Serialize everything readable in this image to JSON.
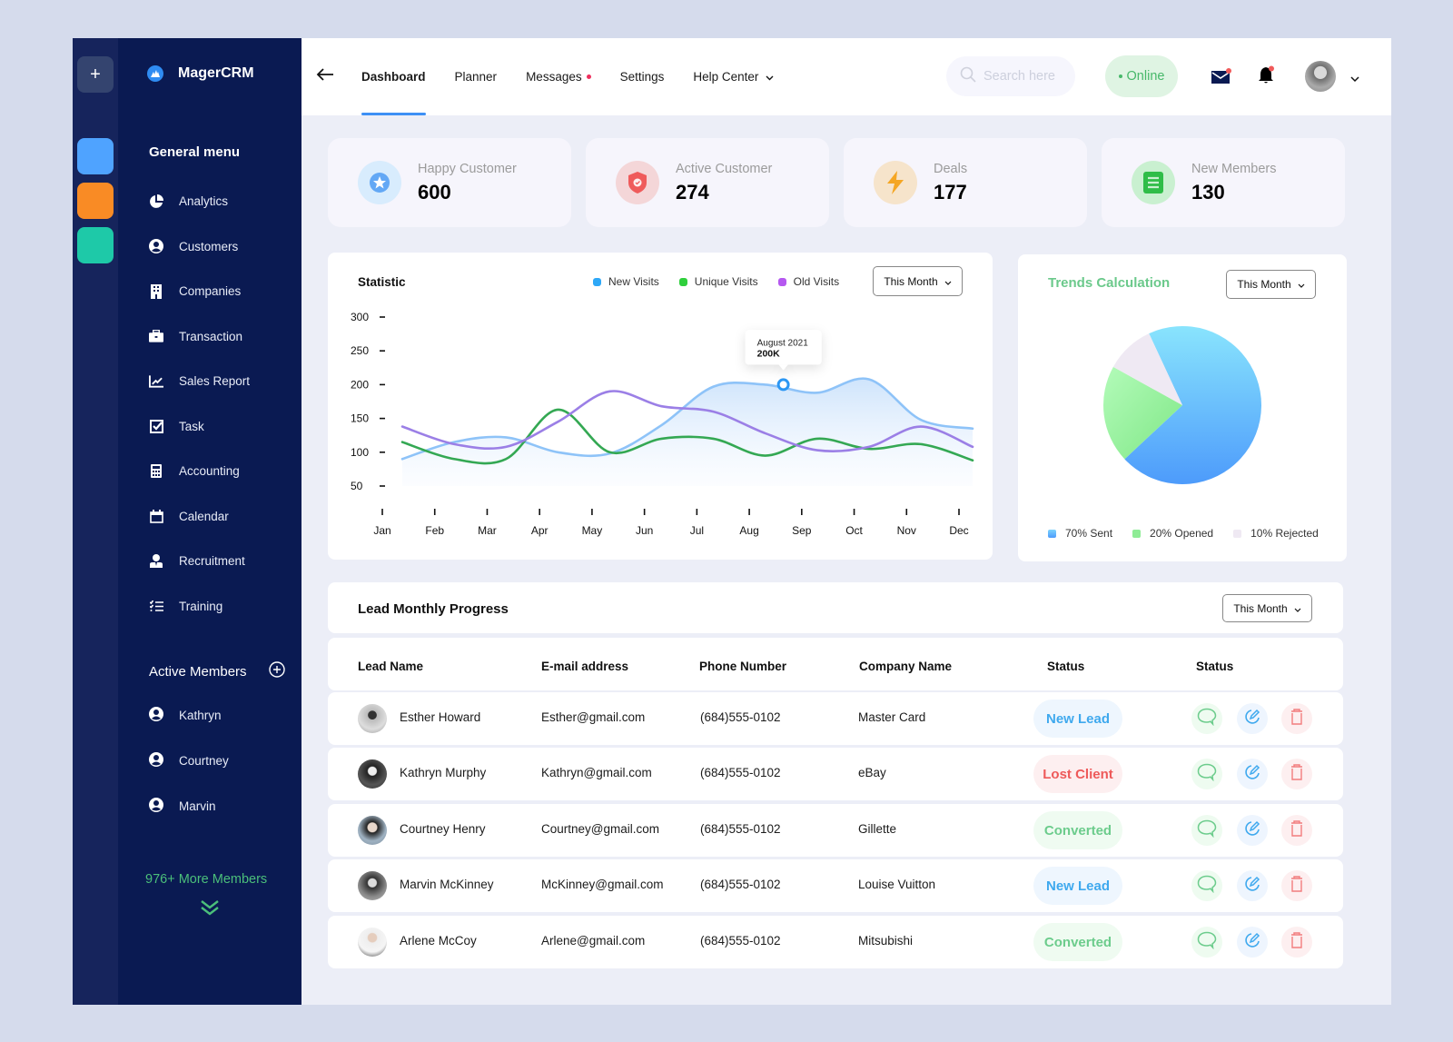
{
  "app": {
    "name": "MagerCRM"
  },
  "rail": {
    "add_label": "+"
  },
  "sidebar": {
    "section_title": "General menu",
    "items": [
      {
        "label": "Analytics",
        "icon": "pie-chart-icon"
      },
      {
        "label": "Customers",
        "icon": "user-circle-icon"
      },
      {
        "label": "Companies",
        "icon": "building-icon"
      },
      {
        "label": "Transaction",
        "icon": "briefcase-icon"
      },
      {
        "label": "Sales Report",
        "icon": "line-chart-icon"
      },
      {
        "label": "Task",
        "icon": "checkbox-icon"
      },
      {
        "label": "Accounting",
        "icon": "calculator-icon"
      },
      {
        "label": "Calendar",
        "icon": "calendar-icon"
      },
      {
        "label": "Recruitment",
        "icon": "recruiter-icon"
      },
      {
        "label": "Training",
        "icon": "checklist-icon"
      }
    ],
    "members_title": "Active Members",
    "members": [
      "Kathryn",
      "Courtney",
      "Marvin"
    ],
    "more_members": "976+ More Members"
  },
  "topbar": {
    "tabs": [
      {
        "label": "Dashboard",
        "active": true
      },
      {
        "label": "Planner"
      },
      {
        "label": "Messages",
        "has_dot": true
      },
      {
        "label": "Settings"
      },
      {
        "label": "Help Center",
        "has_chevron": true
      }
    ],
    "search_placeholder": "Search here",
    "status": "Online"
  },
  "stats": [
    {
      "label": "Happy Customer",
      "value": "600",
      "icon": "star-icon",
      "color": "#63a8f5"
    },
    {
      "label": "Active Customer",
      "value": "274",
      "icon": "shield-icon",
      "color": "#ef5b5b"
    },
    {
      "label": "Deals",
      "value": "177",
      "icon": "lightning-icon",
      "color": "#f5a623"
    },
    {
      "label": "New Members",
      "value": "130",
      "icon": "document-icon",
      "color": "#2fbd48"
    }
  ],
  "chart_data": [
    {
      "type": "line",
      "title": "Statistic",
      "filter": "This Month",
      "categories": [
        "Jan",
        "Feb",
        "Mar",
        "Apr",
        "May",
        "Jun",
        "Jul",
        "Aug",
        "Sep",
        "Oct",
        "Nov",
        "Dec"
      ],
      "yticks": [
        300,
        250,
        200,
        150,
        100,
        50
      ],
      "ylim": [
        50,
        300
      ],
      "series": [
        {
          "name": "New Visits",
          "color": "#8ec3f8",
          "values": [
            90,
            115,
            122,
            100,
            98,
            140,
            197,
            200,
            188,
            208,
            148,
            135
          ]
        },
        {
          "name": "Unique Visits",
          "color": "#34a853",
          "values": [
            115,
            90,
            90,
            163,
            100,
            120,
            120,
            95,
            120,
            105,
            112,
            88
          ]
        },
        {
          "name": "Old Visits",
          "color": "#9b7fe6",
          "values": [
            138,
            112,
            108,
            145,
            190,
            168,
            160,
            128,
            103,
            108,
            138,
            108
          ]
        }
      ],
      "tooltip": {
        "month": "August 2021",
        "value": "200K",
        "category": "Aug",
        "x": 7.35,
        "y": 200
      },
      "legend_position": "top-right"
    },
    {
      "type": "pie",
      "title": "Trends Calculation",
      "filter": "This Month",
      "slices": [
        {
          "label": "Sent",
          "value": 70,
          "legend": "70% Sent",
          "color": "#5aaaf9"
        },
        {
          "label": "Opened",
          "value": 20,
          "legend": "20% Opened",
          "color": "#8fec96"
        },
        {
          "label": "Rejected",
          "value": 10,
          "legend": "10% Rejected",
          "color": "#efe9f3"
        }
      ],
      "legend_position": "bottom"
    }
  ],
  "leads": {
    "title": "Lead Monthly Progress",
    "filter": "This Month",
    "columns": [
      "Lead Name",
      "E-mail address",
      "Phone Number",
      "Company Name",
      "Status",
      "Status"
    ],
    "rows": [
      {
        "name": "Esther Howard",
        "email": "Esther@gmail.com",
        "phone": "(684)555-0102",
        "company": "Master Card",
        "status": "New Lead"
      },
      {
        "name": "Kathryn Murphy",
        "email": "Kathryn@gmail.com",
        "phone": "(684)555-0102",
        "company": "eBay",
        "status": "Lost Client"
      },
      {
        "name": "Courtney Henry",
        "email": "Courtney@gmail.com",
        "phone": "(684)555-0102",
        "company": "Gillette",
        "status": "Converted"
      },
      {
        "name": "Marvin McKinney",
        "email": "McKinney@gmail.com",
        "phone": "(684)555-0102",
        "company": "Louise Vuitton",
        "status": "New Lead"
      },
      {
        "name": "Arlene McCoy",
        "email": "Arlene@gmail.com",
        "phone": "(684)555-0102",
        "company": "Mitsubishi",
        "status": "Converted"
      }
    ],
    "status_colors": {
      "New Lead": {
        "fg": "#3fa9ee",
        "bg": "#eef6fe"
      },
      "Lost Client": {
        "fg": "#ee5a5a",
        "bg": "#fdeff0"
      },
      "Converted": {
        "fg": "#6ccc8c",
        "bg": "#effbf1"
      }
    }
  }
}
